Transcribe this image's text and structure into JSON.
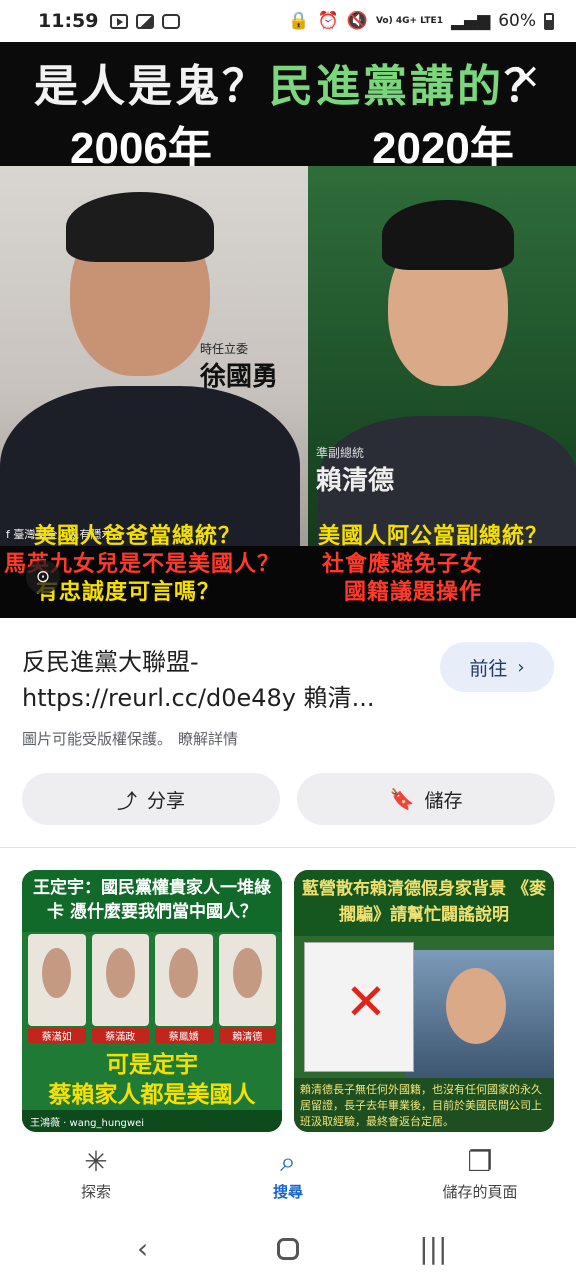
{
  "status_bar": {
    "time": "11:59",
    "network": "Vo) 4G+ LTE1",
    "battery": "60%"
  },
  "hero": {
    "headline_white_1": "是人是鬼？",
    "headline_green": "民進黨講的",
    "headline_white_2": "？",
    "year_left": "2006年",
    "year_right": "2020年",
    "left_role": "時任立委",
    "left_name": "徐國勇",
    "right_role": "準副總統",
    "right_name": "賴清德",
    "credit": "臺灣安全人民有隱才...",
    "left_q1": "美國人爸爸當總統？",
    "left_q2": "馬英九女兒是不是美國人？",
    "left_q3": "有忠誠度可言嗎？",
    "right_q1": "美國人阿公當副總統？",
    "right_q2": "社會應避免子女",
    "right_q3": "國籍議題操作",
    "close_icon": "close-icon",
    "lens_icon": "lens-icon"
  },
  "result": {
    "title": "反民進黨大聯盟- https://reurl.cc/d0e48y 賴清...",
    "goto_label": "前往",
    "copyright": "圖片可能受版權保護。",
    "learn_more": "瞭解詳情",
    "share_label": "分享",
    "save_label": "儲存"
  },
  "thumbnails": [
    {
      "headline": "王定宇：國民黨權貴家人一堆綠卡 憑什麼要我們當中國人？",
      "labels": [
        "蔡滿如",
        "蔡滿政",
        "蔡鳳嬌",
        "賴清德"
      ],
      "yellow_line_1": "可是定宇",
      "yellow_line_2": "蔡賴家人都是美國人",
      "footer": "王鴻薇 · wang_hungwei"
    },
    {
      "headline": "藍營散布賴清德假身家背景 《麥擱騙》請幫忙闢謠說明",
      "body": "賴清德長子無任何外國籍，也沒有任何國家的永久居留證，長子去年畢業後，目前於美國民間公司上班汲取經驗，最終會返台定居。"
    }
  ],
  "bottom_nav": {
    "items": [
      {
        "label": "探索",
        "icon": "asterisk-icon"
      },
      {
        "label": "搜尋",
        "icon": "search-icon"
      },
      {
        "label": "儲存的頁面",
        "icon": "bookmarks-icon"
      }
    ]
  },
  "colors": {
    "accent": "#1a66d2",
    "pill_bg": "#eeeef0",
    "goto_bg": "#e8eef9"
  }
}
